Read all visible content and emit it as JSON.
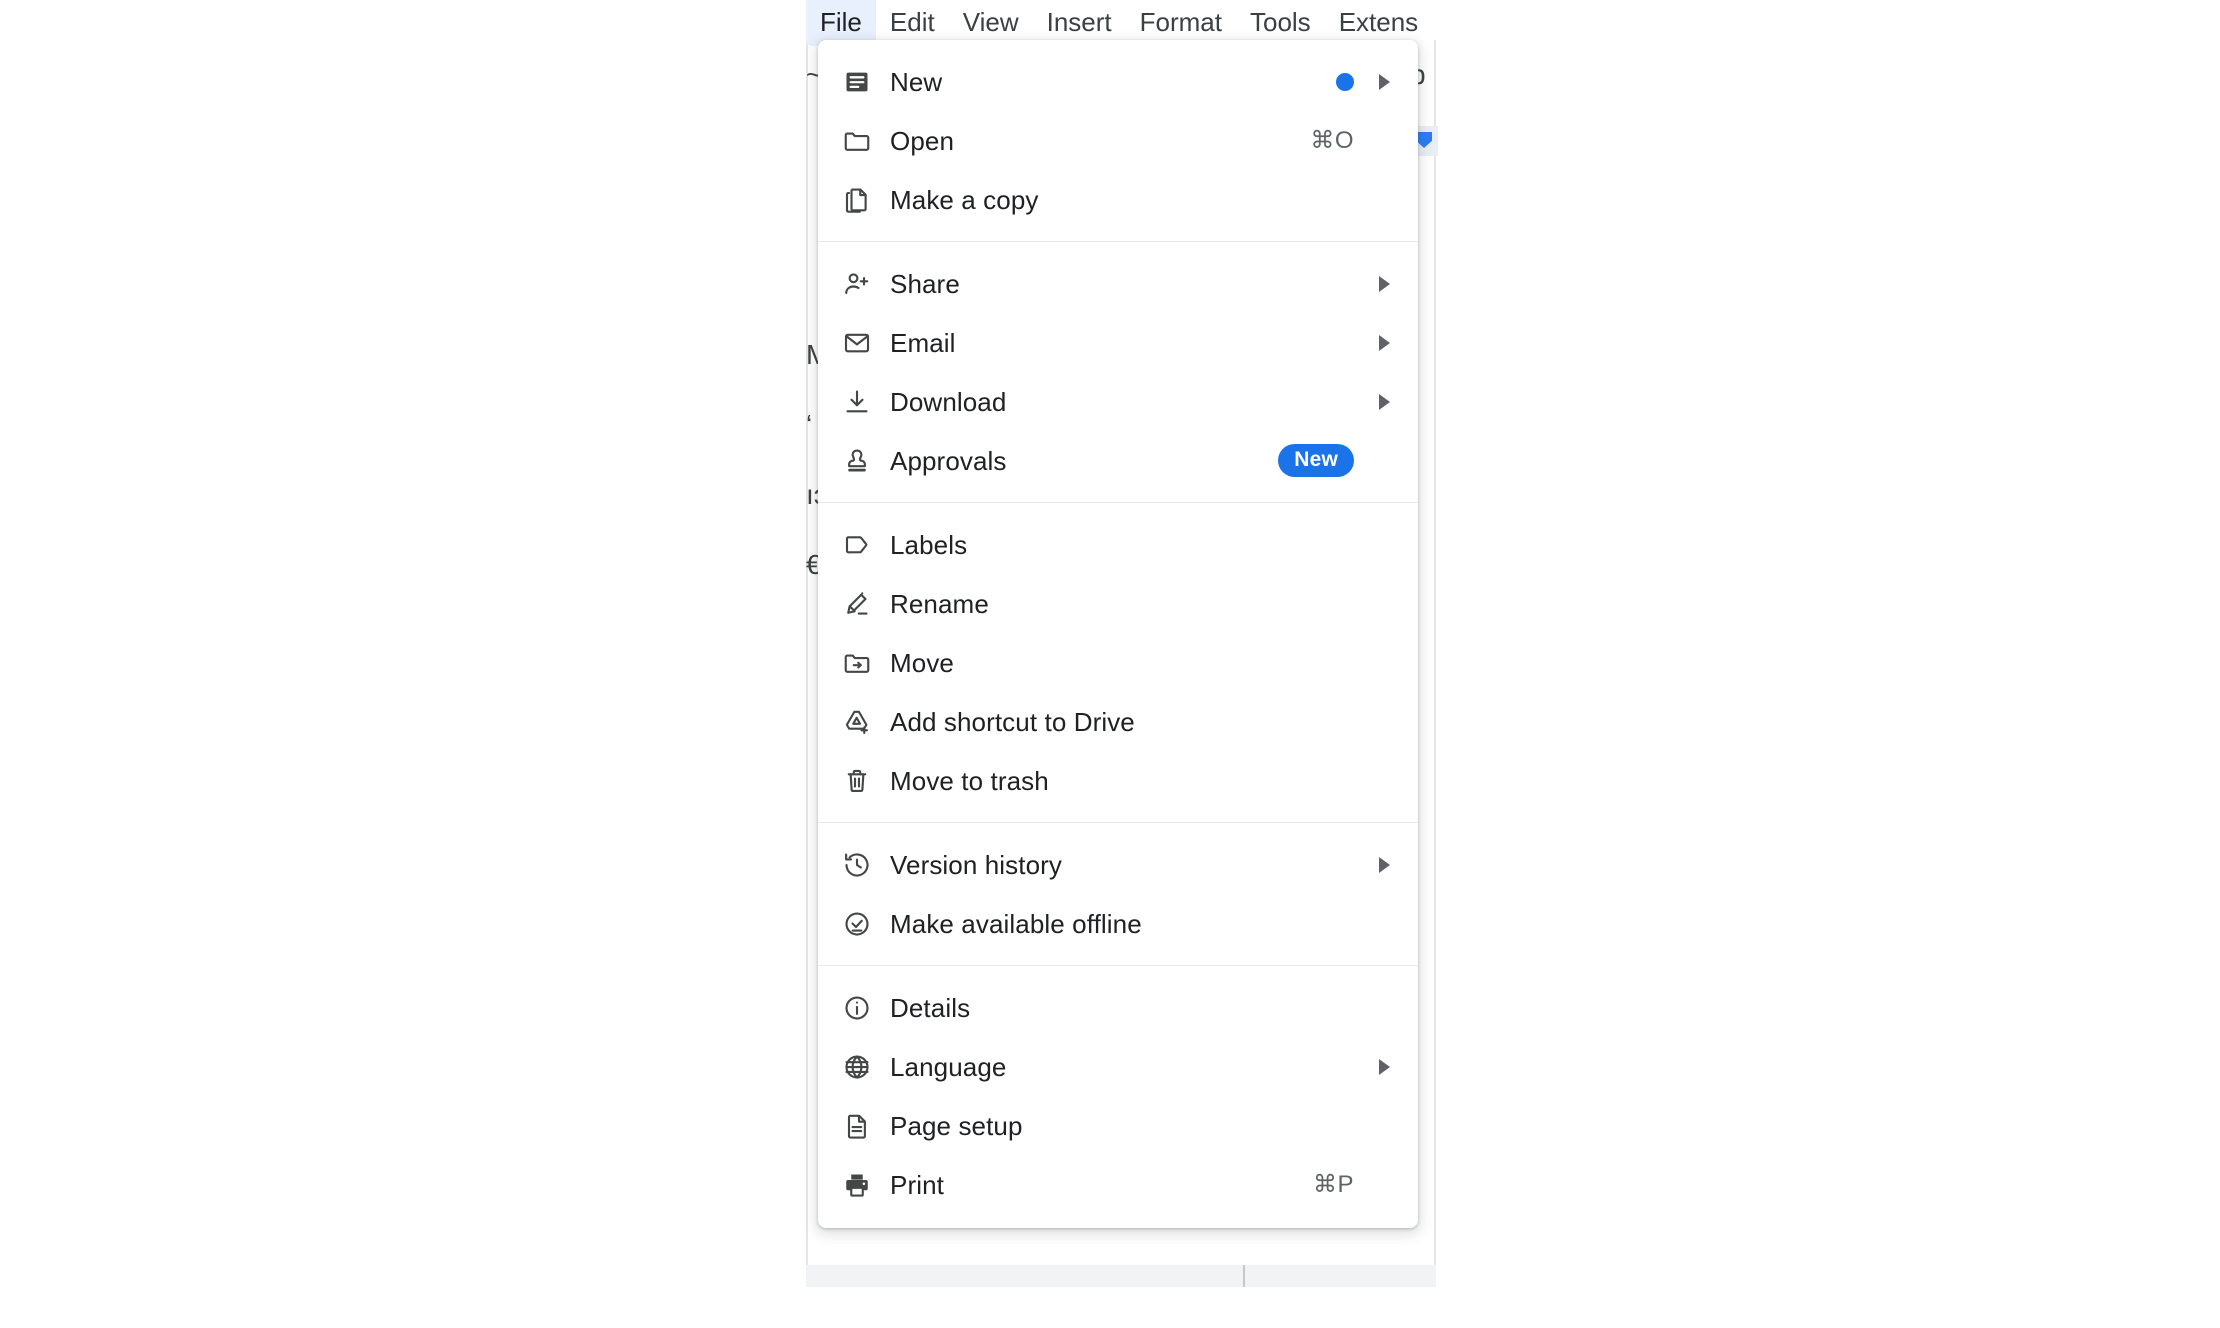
{
  "menubar": {
    "items": [
      {
        "label": "File",
        "active": true
      },
      {
        "label": "Edit",
        "active": false
      },
      {
        "label": "View",
        "active": false
      },
      {
        "label": "Insert",
        "active": false
      },
      {
        "label": "Format",
        "active": false
      },
      {
        "label": "Tools",
        "active": false
      },
      {
        "label": "Extens",
        "active": false
      }
    ]
  },
  "colors": {
    "accent_blue": "#1a73e8",
    "menubar_active_bg": "#e8f0fe",
    "menu_bg": "#ffffff",
    "separator": "#e8eaed",
    "label_text": "#202124",
    "accel_text": "#5f6368",
    "icon": "#444746"
  },
  "background": {
    "left_fragments": [
      "~",
      "",
      "",
      "",
      "M",
      "‘",
      "ıɔ",
      "€",
      "",
      "",
      "",
      "",
      "",
      "",
      "",
      "",
      "",
      ""
    ],
    "right_fragments": [
      "b",
      "",
      "",
      "",
      "",
      "",
      "",
      "",
      "",
      "",
      "",
      "",
      "",
      "",
      "",
      "",
      "",
      ""
    ]
  },
  "file_menu": {
    "groups": [
      {
        "items": [
          {
            "label": "New",
            "icon": "new-document-icon",
            "dot": true,
            "submenu": true,
            "accel": ""
          },
          {
            "label": "Open",
            "icon": "folder-icon",
            "dot": false,
            "submenu": false,
            "accel": "⌘O"
          },
          {
            "label": "Make a copy",
            "icon": "copy-icon",
            "dot": false,
            "submenu": false,
            "accel": ""
          }
        ]
      },
      {
        "items": [
          {
            "label": "Share",
            "icon": "person-add-icon",
            "dot": false,
            "submenu": true,
            "accel": ""
          },
          {
            "label": "Email",
            "icon": "envelope-icon",
            "dot": false,
            "submenu": true,
            "accel": ""
          },
          {
            "label": "Download",
            "icon": "download-icon",
            "dot": false,
            "submenu": true,
            "accel": ""
          },
          {
            "label": "Approvals",
            "icon": "stamp-icon",
            "dot": false,
            "submenu": false,
            "accel": "",
            "badge": "New"
          }
        ]
      },
      {
        "items": [
          {
            "label": "Labels",
            "icon": "label-tag-icon",
            "dot": false,
            "submenu": false,
            "accel": ""
          },
          {
            "label": "Rename",
            "icon": "pencil-icon",
            "dot": false,
            "submenu": false,
            "accel": ""
          },
          {
            "label": "Move",
            "icon": "folder-move-icon",
            "dot": false,
            "submenu": false,
            "accel": ""
          },
          {
            "label": "Add shortcut to Drive",
            "icon": "drive-add-shortcut-icon",
            "dot": false,
            "submenu": false,
            "accel": ""
          },
          {
            "label": "Move to trash",
            "icon": "trash-icon",
            "dot": false,
            "submenu": false,
            "accel": ""
          }
        ]
      },
      {
        "items": [
          {
            "label": "Version history",
            "icon": "history-clock-icon",
            "dot": false,
            "submenu": true,
            "accel": ""
          },
          {
            "label": "Make available offline",
            "icon": "offline-check-icon",
            "dot": false,
            "submenu": false,
            "accel": ""
          }
        ]
      },
      {
        "items": [
          {
            "label": "Details",
            "icon": "info-icon",
            "dot": false,
            "submenu": false,
            "accel": ""
          },
          {
            "label": "Language",
            "icon": "globe-icon",
            "dot": false,
            "submenu": true,
            "accel": ""
          },
          {
            "label": "Page setup",
            "icon": "page-setup-icon",
            "dot": false,
            "submenu": false,
            "accel": ""
          },
          {
            "label": "Print",
            "icon": "printer-icon",
            "dot": false,
            "submenu": false,
            "accel": "⌘P"
          }
        ]
      }
    ]
  }
}
